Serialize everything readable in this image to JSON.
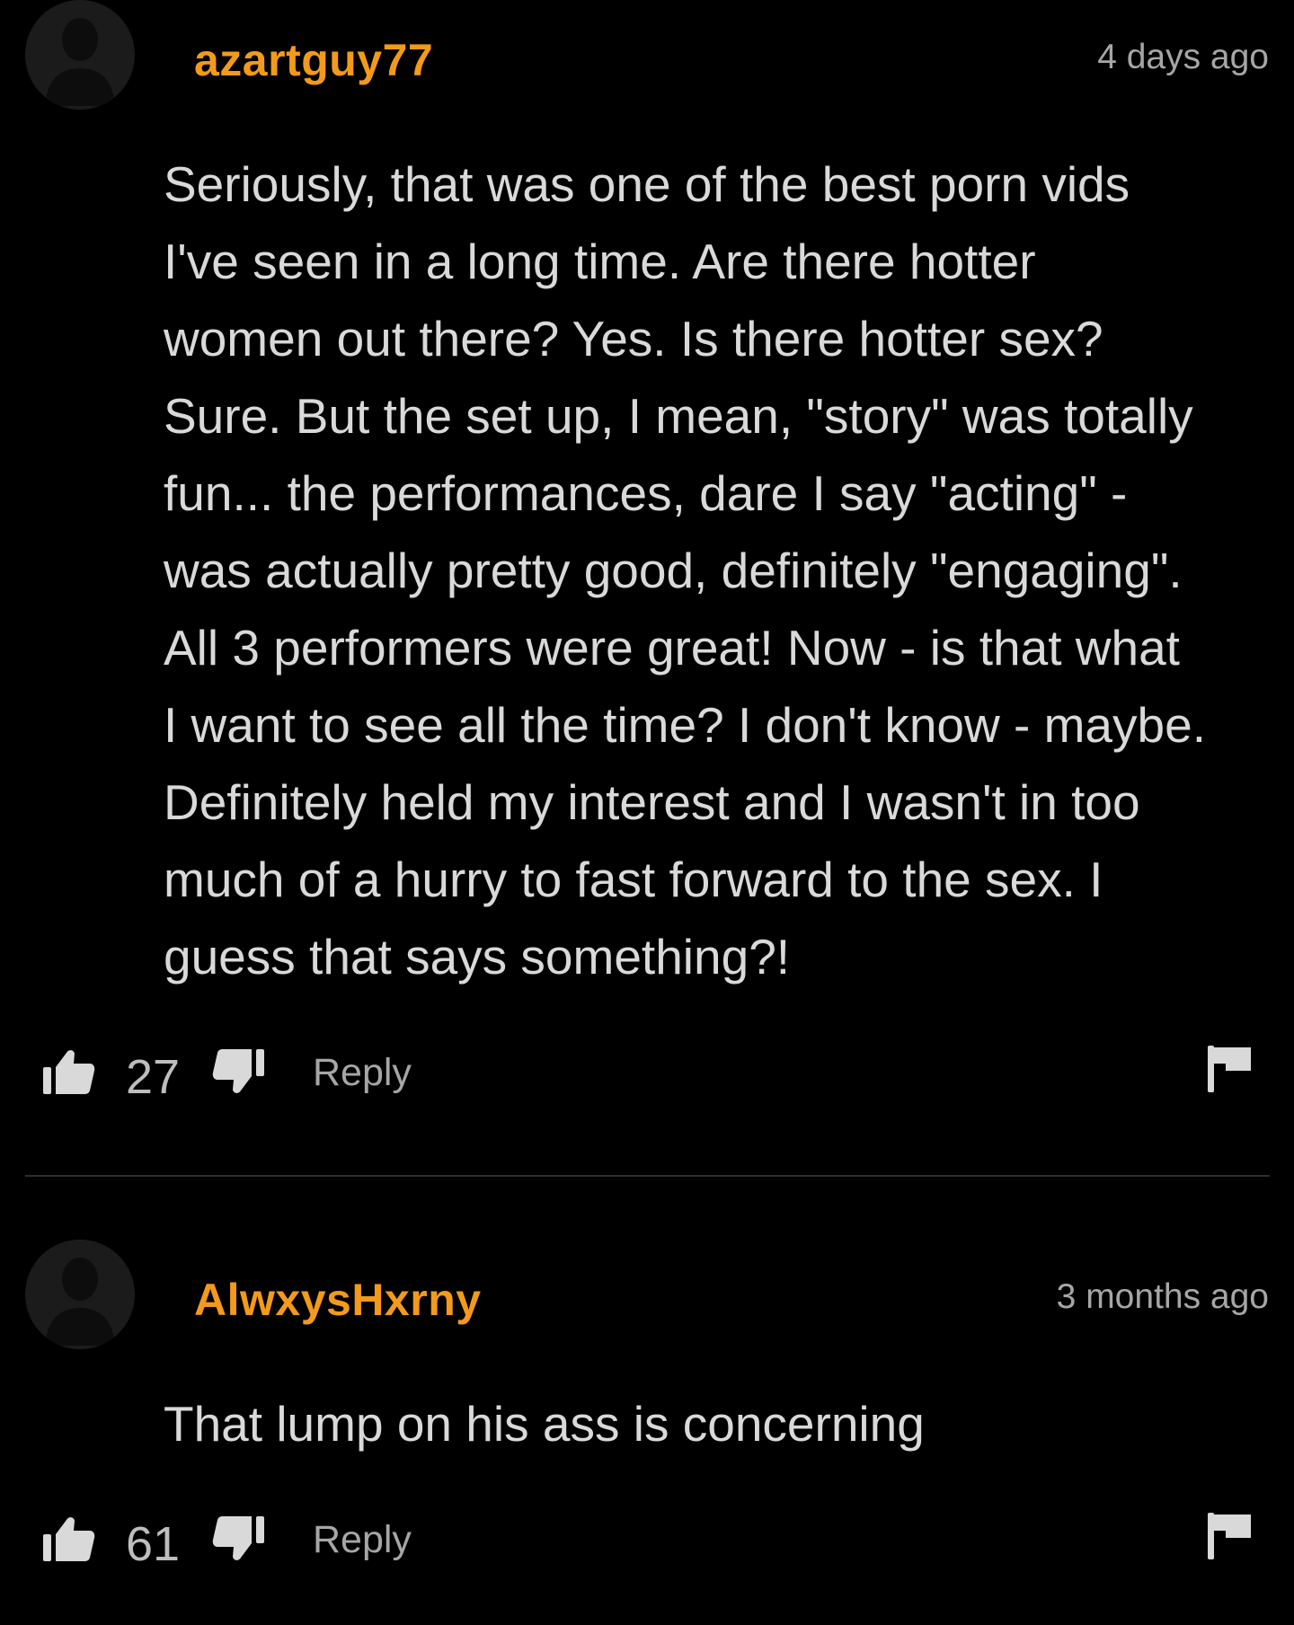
{
  "colors": {
    "background": "#000000",
    "username": "#f39a1b",
    "body_text": "#d9d9d9",
    "meta_text": "#a6a6a6",
    "icon": "#d9d9d9"
  },
  "comments": [
    {
      "username": "azartguy77",
      "timestamp": "4 days ago",
      "text": "Seriously, that was one of the best porn vids\nI've seen in a long time. Are there hotter\nwomen out there? Yes. Is there hotter sex?\nSure. But the set up, I mean, \"story\" was totally\nfun... the performances, dare I say \"acting\" -\nwas actually pretty good, definitely \"engaging\".\nAll 3 performers were great! Now - is that what\nI want to see all the time? I don't know - maybe.\nDefinitely held my interest and I wasn't in too\nmuch of a hurry to fast forward to the sex. I\nguess that says something?!",
      "likes": "27",
      "reply_label": "Reply",
      "icons": [
        "avatar-placeholder-icon",
        "thumbs-up-icon",
        "thumbs-down-icon",
        "flag-icon"
      ]
    },
    {
      "username": "AlwxysHxrny",
      "timestamp": "3 months ago",
      "text": "That lump on his ass is concerning",
      "likes": "61",
      "reply_label": "Reply",
      "icons": [
        "avatar-placeholder-icon",
        "thumbs-up-icon",
        "thumbs-down-icon",
        "flag-icon"
      ]
    }
  ]
}
